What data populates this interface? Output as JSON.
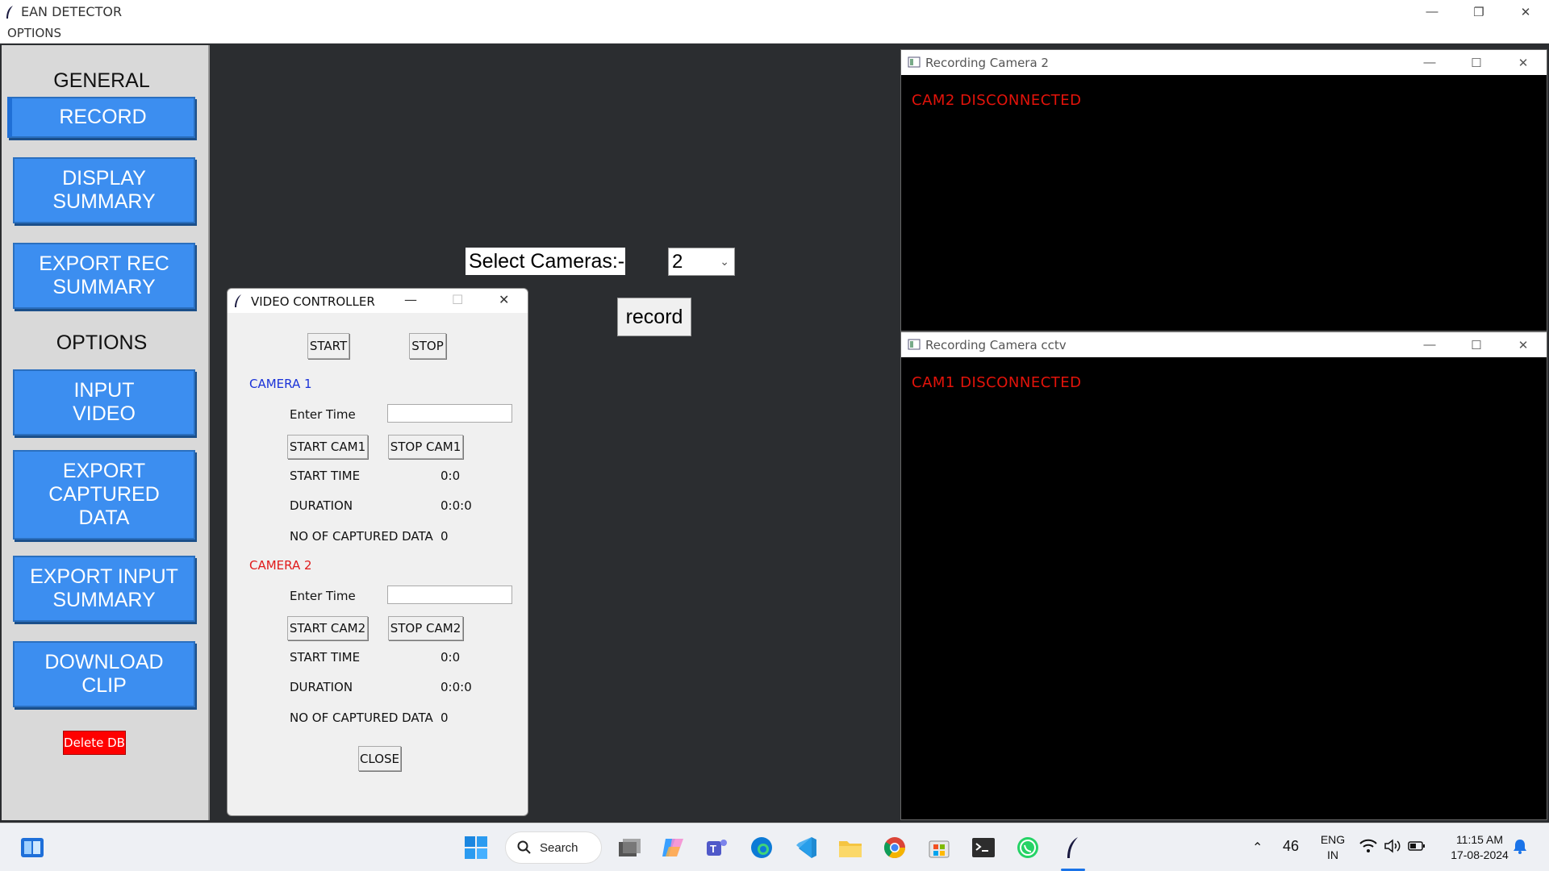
{
  "window": {
    "title": "EAN DETECTOR",
    "menu": "OPTIONS"
  },
  "sidebar": {
    "general_heading": "GENERAL",
    "options_heading": "OPTIONS",
    "buttons": {
      "record": "RECORD",
      "display_summary": "DISPLAY\nSUMMARY",
      "export_rec_summary": "EXPORT REC\nSUMMARY",
      "input_video": "INPUT\nVIDEO",
      "export_captured_data": "EXPORT\nCAPTURED\nDATA",
      "export_input_summary": "EXPORT INPUT\nSUMMARY",
      "download_clip": "DOWNLOAD\nCLIP"
    },
    "delete_db": "Delete DB"
  },
  "main": {
    "select_label": "Select Cameras:-",
    "camera_count": "2",
    "record_button": "record"
  },
  "video_controller": {
    "title": "VIDEO CONTROLLER",
    "start": "START",
    "stop": "STOP",
    "close": "CLOSE",
    "camera1": {
      "title": "CAMERA 1",
      "enter_time_label": "Enter Time",
      "enter_time_value": "",
      "start_button": "START CAM1",
      "stop_button": "STOP CAM1",
      "start_time_label": "START TIME",
      "start_time_value": "0:0",
      "duration_label": "DURATION",
      "duration_value": "0:0:0",
      "captured_label": "NO OF CAPTURED DATA",
      "captured_value": "0"
    },
    "camera2": {
      "title": "CAMERA 2",
      "enter_time_label": "Enter Time",
      "enter_time_value": "",
      "start_button": "START CAM2",
      "stop_button": "STOP CAM2",
      "start_time_label": "START TIME",
      "start_time_value": "0:0",
      "duration_label": "DURATION",
      "duration_value": "0:0:0",
      "captured_label": "NO OF CAPTURED DATA",
      "captured_value": "0"
    }
  },
  "recording_windows": [
    {
      "title": "Recording Camera 2",
      "status": "CAM2  DISCONNECTED"
    },
    {
      "title": "Recording Camera cctv",
      "status": "CAM1  DISCONNECTED"
    }
  ],
  "taskbar": {
    "search": "Search",
    "weather": "46",
    "lang_line1": "ENG",
    "lang_line2": "IN",
    "time": "11:15 AM",
    "date": "17-08-2024"
  },
  "colors": {
    "sidebar_button": "#3c8ef0",
    "delete_button": "#ff0000",
    "camera1_title": "#1a32d8",
    "camera2_title": "#e01a1a",
    "status_text": "#e3130a"
  }
}
